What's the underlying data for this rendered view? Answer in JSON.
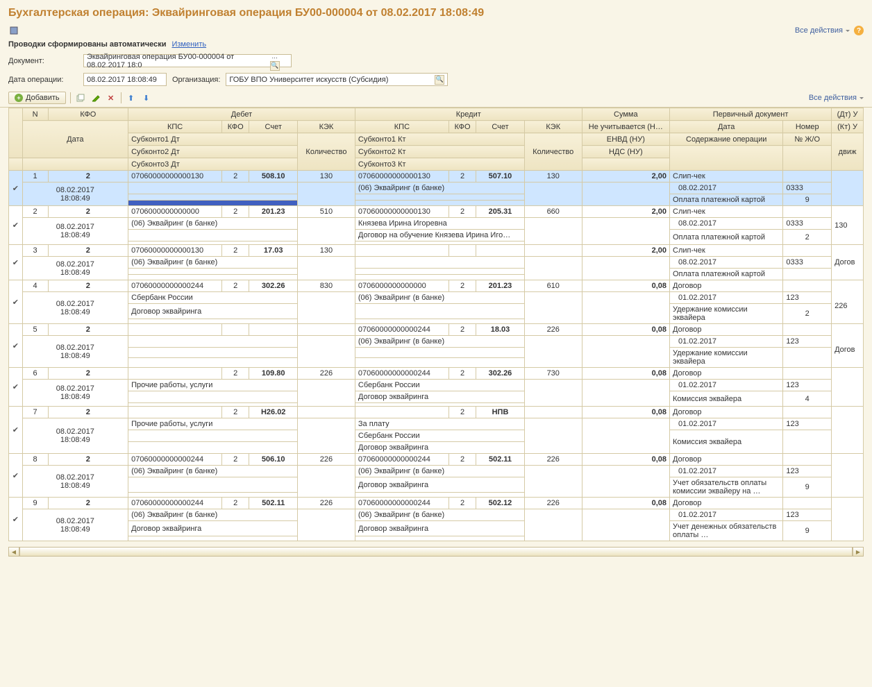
{
  "title": "Бухгалтерская операция: Эквайринговая операция БУ00-000004 от 08.02.2017 18:08:49",
  "all_actions": "Все действия",
  "info_line": {
    "text": "Проводки сформированы автоматически",
    "change": "Изменить"
  },
  "fields": {
    "doc_label": "Документ:",
    "doc_value": "Эквайринговая операция БУ00-000004 от 08.02.2017 18:0",
    "date_label": "Дата операции:",
    "date_value": "08.02.2017 18:08:49",
    "org_label": "Организация:",
    "org_value": "ГОБУ ВПО Университет искусств (Субсидия)"
  },
  "toolbar": {
    "add": "Добавить"
  },
  "headers": {
    "n": "N",
    "kfo": "КФО",
    "debit": "Дебет",
    "credit": "Кредит",
    "sum": "Сумма",
    "primary": "Первичный документ",
    "dt": "(Дт) У",
    "date": "Дата",
    "kps": "КПС",
    "acct": "Счет",
    "kek": "КЭК",
    "no_take": "Не учитывается (Н…",
    "date2": "Дата",
    "number": "Номер",
    "kt": "(Кт) У",
    "sub1d": "Субконто1 Дт",
    "sub2d": "Субконто2 Дт",
    "sub3d": "Субконто3 Дт",
    "sub1k": "Субконто1 Кт",
    "sub2k": "Субконто2 Кт",
    "sub3k": "Субконто3 Кт",
    "qty": "Количество",
    "envd": "ЕНВД (НУ)",
    "nds": "НДС (НУ)",
    "content": "Содержание операции",
    "jo": "№ Ж/О",
    "move": "движ"
  },
  "rows": [
    {
      "n": "1",
      "kfo": "2",
      "date": "08.02.2017 18:08:49",
      "d_kps": "07060000000000130",
      "d_kfo": "2",
      "d_acct": "508.10",
      "d_kek": "130",
      "d_s1": "",
      "d_s2": "",
      "d_s3": "",
      "k_kps": "07060000000000130",
      "k_kfo": "2",
      "k_acct": "507.10",
      "k_kek": "130",
      "k_s1": "(06) Эквайринг (в банке)",
      "k_s2": "",
      "k_s3": "",
      "sum": "2,00",
      "doc": "Слип-чек",
      "doc_date": "08.02.2017",
      "doc_num": "0333",
      "content": "Оплата платежной картой",
      "jo": "9",
      "dtv": "",
      "ktv": "",
      "selected": true
    },
    {
      "n": "2",
      "kfo": "2",
      "date": "08.02.2017 18:08:49",
      "d_kps": "0706000000000000",
      "d_kfo": "2",
      "d_acct": "201.23",
      "d_kek": "510",
      "d_s1": "(06) Эквайринг (в банке)",
      "d_s2": "",
      "d_s3": "",
      "k_kps": "07060000000000130",
      "k_kfo": "2",
      "k_acct": "205.31",
      "k_kek": "660",
      "k_s1": "Князева Ирина Игоревна",
      "k_s2": "Договор на обучение Князева Ирина Иго…",
      "k_s3": "",
      "sum": "2,00",
      "doc": "Слип-чек",
      "doc_date": "08.02.2017",
      "doc_num": "0333",
      "content": "Оплата платежной картой",
      "jo": "2",
      "dtv": "130",
      "ktv": ""
    },
    {
      "n": "3",
      "kfo": "2",
      "date": "08.02.2017 18:08:49",
      "d_kps": "07060000000000130",
      "d_kfo": "2",
      "d_acct": "17.03",
      "d_kek": "130",
      "d_s1": "(06) Эквайринг (в банке)",
      "d_s2": "",
      "d_s3": "",
      "k_kps": "",
      "k_kfo": "",
      "k_acct": "",
      "k_kek": "",
      "k_s1": "",
      "k_s2": "",
      "k_s3": "",
      "sum": "2,00",
      "doc": "Слип-чек",
      "doc_date": "08.02.2017",
      "doc_num": "0333",
      "content": "Оплата платежной картой",
      "jo": "",
      "dtv": "Догов",
      "ktv": ""
    },
    {
      "n": "4",
      "kfo": "2",
      "date": "08.02.2017 18:08:49",
      "d_kps": "07060000000000244",
      "d_kfo": "2",
      "d_acct": "302.26",
      "d_kek": "830",
      "d_s1": "Сбербанк России",
      "d_s2": "Договор эквайринга",
      "d_s3": "",
      "k_kps": "0706000000000000",
      "k_kfo": "2",
      "k_acct": "201.23",
      "k_kek": "610",
      "k_s1": "(06) Эквайринг (в банке)",
      "k_s2": "",
      "k_s3": "",
      "sum": "0,08",
      "doc": "Договор",
      "doc_date": "01.02.2017",
      "doc_num": "123",
      "content": "Удержание комиссии эквайера",
      "jo": "2",
      "dtv": "",
      "ktv": "226"
    },
    {
      "n": "5",
      "kfo": "2",
      "date": "08.02.2017 18:08:49",
      "d_kps": "",
      "d_kfo": "",
      "d_acct": "",
      "d_kek": "",
      "d_s1": "",
      "d_s2": "",
      "d_s3": "",
      "k_kps": "07060000000000244",
      "k_kfo": "2",
      "k_acct": "18.03",
      "k_kek": "226",
      "k_s1": "(06) Эквайринг (в банке)",
      "k_s2": "",
      "k_s3": "",
      "sum": "0,08",
      "doc": "Договор",
      "doc_date": "01.02.2017",
      "doc_num": "123",
      "content": "Удержание комиссии эквайера",
      "jo": "",
      "dtv": "",
      "ktv": "Догов"
    },
    {
      "n": "6",
      "kfo": "2",
      "date": "08.02.2017 18:08:49",
      "d_kps": "",
      "d_kfo": "2",
      "d_acct": "109.80",
      "d_kek": "226",
      "d_s1": "Прочие работы, услуги",
      "d_s2": "",
      "d_s3": "",
      "k_kps": "07060000000000244",
      "k_kfo": "2",
      "k_acct": "302.26",
      "k_kek": "730",
      "k_s1": "Сбербанк России",
      "k_s2": "Договор эквайринга",
      "k_s3": "",
      "sum": "0,08",
      "doc": "Договор",
      "doc_date": "01.02.2017",
      "doc_num": "123",
      "content": "Комиссия эквайера",
      "jo": "4",
      "dtv": "",
      "ktv": ""
    },
    {
      "n": "7",
      "kfo": "2",
      "date": "08.02.2017 18:08:49",
      "d_kps": "",
      "d_kfo": "2",
      "d_acct": "Н26.02",
      "d_kek": "",
      "d_s1": "Прочие работы, услуги",
      "d_s2": "",
      "d_s3": "",
      "k_kps": "",
      "k_kfo": "2",
      "k_acct": "НПВ",
      "k_kek": "",
      "k_s1": "За плату",
      "k_s2": "Сбербанк России",
      "k_s3": "Договор эквайринга",
      "sum": "0,08",
      "doc": "Договор",
      "doc_date": "01.02.2017",
      "doc_num": "123",
      "content": "Комиссия эквайера",
      "jo": "",
      "dtv": "",
      "ktv": ""
    },
    {
      "n": "8",
      "kfo": "2",
      "date": "08.02.2017 18:08:49",
      "d_kps": "07060000000000244",
      "d_kfo": "2",
      "d_acct": "506.10",
      "d_kek": "226",
      "d_s1": "(06) Эквайринг (в банке)",
      "d_s2": "",
      "d_s3": "",
      "k_kps": "07060000000000244",
      "k_kfo": "2",
      "k_acct": "502.11",
      "k_kek": "226",
      "k_s1": "(06) Эквайринг (в банке)",
      "k_s2": "Договор эквайринга",
      "k_s3": "",
      "sum": "0,08",
      "doc": "Договор",
      "doc_date": "01.02.2017",
      "doc_num": "123",
      "content": "Учет обязательств оплаты комиссии эквайеру на …",
      "jo": "9",
      "dtv": "",
      "ktv": ""
    },
    {
      "n": "9",
      "kfo": "2",
      "date": "08.02.2017 18:08:49",
      "d_kps": "07060000000000244",
      "d_kfo": "2",
      "d_acct": "502.11",
      "d_kek": "226",
      "d_s1": "(06) Эквайринг (в банке)",
      "d_s2": "Договор эквайринга",
      "d_s3": "",
      "k_kps": "07060000000000244",
      "k_kfo": "2",
      "k_acct": "502.12",
      "k_kek": "226",
      "k_s1": "(06) Эквайринг (в банке)",
      "k_s2": "Договор эквайринга",
      "k_s3": "",
      "sum": "0,08",
      "doc": "Договор",
      "doc_date": "01.02.2017",
      "doc_num": "123",
      "content": "Учет денежных обязательств оплаты …",
      "jo": "9",
      "dtv": "",
      "ktv": ""
    }
  ]
}
